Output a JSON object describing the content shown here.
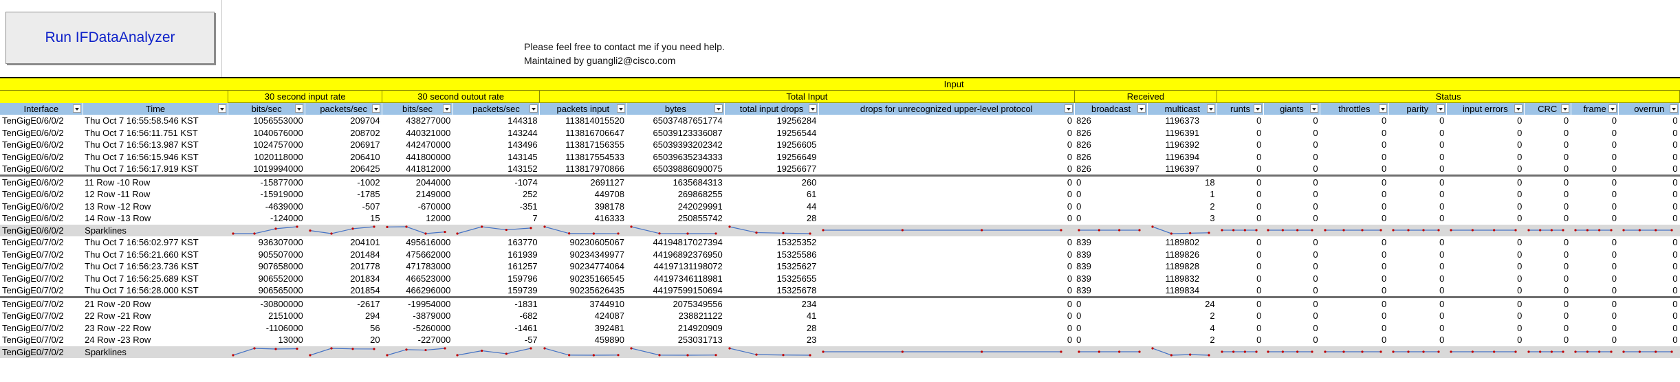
{
  "toolbar": {
    "run_label": "Run IFDataAnalyzer"
  },
  "contact": {
    "line1": "Please feel free to contact me if you need help.",
    "line2": "Maintained by guangli2@cisco.com"
  },
  "bands": {
    "input": "Input",
    "rate_in": "30 second input rate",
    "rate_out": "30 second outout rate",
    "total_input": "Total Input",
    "received": "Received",
    "status": "Status"
  },
  "columns": [
    "Interface",
    "Time",
    "bits/sec",
    "packets/sec",
    "bits/sec",
    "packets/sec",
    "packets input",
    "bytes",
    "total input drops",
    "drops for unrecognized upper-level protocol",
    "broadcast",
    "multicast",
    "runts",
    "giants",
    "throttles",
    "parity",
    "input errors",
    "CRC",
    "frame",
    "overrun"
  ],
  "groups": [
    {
      "rows": [
        [
          "TenGigE0/6/0/2",
          "Thu Oct  7 16:55:58.546 KST",
          "1056553000",
          "209704",
          "438277000",
          "144318",
          "113814015520",
          "65037487651774",
          "19256284",
          "0",
          "826",
          "1196373",
          "0",
          "0",
          "0",
          "0",
          "0",
          "0",
          "0",
          "0"
        ],
        [
          "TenGigE0/6/0/2",
          "Thu Oct  7 16:56:11.751 KST",
          "1040676000",
          "208702",
          "440321000",
          "143244",
          "113816706647",
          "65039123336087",
          "19256544",
          "0",
          "826",
          "1196391",
          "0",
          "0",
          "0",
          "0",
          "0",
          "0",
          "0",
          "0"
        ],
        [
          "TenGigE0/6/0/2",
          "Thu Oct  7 16:56:13.987 KST",
          "1024757000",
          "206917",
          "442470000",
          "143496",
          "113817156355",
          "65039393202342",
          "19256605",
          "0",
          "826",
          "1196392",
          "0",
          "0",
          "0",
          "0",
          "0",
          "0",
          "0",
          "0"
        ],
        [
          "TenGigE0/6/0/2",
          "Thu Oct  7 16:56:15.946 KST",
          "1020118000",
          "206410",
          "441800000",
          "143145",
          "113817554533",
          "65039635234333",
          "19256649",
          "0",
          "826",
          "1196394",
          "0",
          "0",
          "0",
          "0",
          "0",
          "0",
          "0",
          "0"
        ],
        [
          "TenGigE0/6/0/2",
          "Thu Oct  7 16:56:17.919 KST",
          "1019994000",
          "206425",
          "441812000",
          "143152",
          "113817970866",
          "65039886090075",
          "19256677",
          "0",
          "826",
          "1196397",
          "0",
          "0",
          "0",
          "0",
          "0",
          "0",
          "0",
          "0"
        ]
      ],
      "diffs": [
        [
          "TenGigE0/6/0/2",
          "11 Row -10 Row",
          "-15877000",
          "-1002",
          "2044000",
          "-1074",
          "2691127",
          "1635684313",
          "260",
          "0",
          "0",
          "18",
          "0",
          "0",
          "0",
          "0",
          "0",
          "0",
          "0",
          "0"
        ],
        [
          "TenGigE0/6/0/2",
          "12 Row -11 Row",
          "-15919000",
          "-1785",
          "2149000",
          "252",
          "449708",
          "269868255",
          "61",
          "0",
          "0",
          "1",
          "0",
          "0",
          "0",
          "0",
          "0",
          "0",
          "0",
          "0"
        ],
        [
          "TenGigE0/6/0/2",
          "13 Row -12 Row",
          "-4639000",
          "-507",
          "-670000",
          "-351",
          "398178",
          "242029991",
          "44",
          "0",
          "0",
          "2",
          "0",
          "0",
          "0",
          "0",
          "0",
          "0",
          "0",
          "0"
        ],
        [
          "TenGigE0/6/0/2",
          "14 Row -13 Row",
          "-124000",
          "15",
          "12000",
          "7",
          "416333",
          "250855742",
          "28",
          "0",
          "0",
          "3",
          "0",
          "0",
          "0",
          "0",
          "0",
          "0",
          "0",
          "0"
        ]
      ],
      "spark": {
        "interface": "TenGigE0/6/0/2",
        "label": "Sparklines"
      }
    },
    {
      "rows": [
        [
          "TenGigE0/7/0/2",
          "Thu Oct  7 16:56:02.977 KST",
          "936307000",
          "204101",
          "495616000",
          "163770",
          "90230605067",
          "44194817027394",
          "15325352",
          "0",
          "839",
          "1189802",
          "0",
          "0",
          "0",
          "0",
          "0",
          "0",
          "0",
          "0"
        ],
        [
          "TenGigE0/7/0/2",
          "Thu Oct  7 16:56:21.660 KST",
          "905507000",
          "201484",
          "475662000",
          "161939",
          "90234349977",
          "44196892376950",
          "15325586",
          "0",
          "839",
          "1189826",
          "0",
          "0",
          "0",
          "0",
          "0",
          "0",
          "0",
          "0"
        ],
        [
          "TenGigE0/7/0/2",
          "Thu Oct  7 16:56:23.736 KST",
          "907658000",
          "201778",
          "471783000",
          "161257",
          "90234774064",
          "44197131198072",
          "15325627",
          "0",
          "839",
          "1189828",
          "0",
          "0",
          "0",
          "0",
          "0",
          "0",
          "0",
          "0"
        ],
        [
          "TenGigE0/7/0/2",
          "Thu Oct  7 16:56:25.689 KST",
          "906552000",
          "201834",
          "466523000",
          "159796",
          "90235166545",
          "44197346118981",
          "15325655",
          "0",
          "839",
          "1189832",
          "0",
          "0",
          "0",
          "0",
          "0",
          "0",
          "0",
          "0"
        ],
        [
          "TenGigE0/7/0/2",
          "Thu Oct  7 16:56:28.000 KST",
          "906565000",
          "201854",
          "466296000",
          "159739",
          "90235626435",
          "44197599150694",
          "15325678",
          "0",
          "839",
          "1189834",
          "0",
          "0",
          "0",
          "0",
          "0",
          "0",
          "0",
          "0"
        ]
      ],
      "diffs": [
        [
          "TenGigE0/7/0/2",
          "21 Row -20 Row",
          "-30800000",
          "-2617",
          "-19954000",
          "-1831",
          "3744910",
          "2075349556",
          "234",
          "0",
          "0",
          "24",
          "0",
          "0",
          "0",
          "0",
          "0",
          "0",
          "0",
          "0"
        ],
        [
          "TenGigE0/7/0/2",
          "22 Row -21 Row",
          "2151000",
          "294",
          "-3879000",
          "-682",
          "424087",
          "238821122",
          "41",
          "0",
          "0",
          "2",
          "0",
          "0",
          "0",
          "0",
          "0",
          "0",
          "0",
          "0"
        ],
        [
          "TenGigE0/7/0/2",
          "23 Row -22 Row",
          "-1106000",
          "56",
          "-5260000",
          "-1461",
          "392481",
          "214920909",
          "28",
          "0",
          "0",
          "4",
          "0",
          "0",
          "0",
          "0",
          "0",
          "0",
          "0",
          "0"
        ],
        [
          "TenGigE0/7/0/2",
          "24 Row -23 Row",
          "13000",
          "20",
          "-227000",
          "-57",
          "459890",
          "253031713",
          "23",
          "0",
          "0",
          "2",
          "0",
          "0",
          "0",
          "0",
          "0",
          "0",
          "0",
          "0"
        ]
      ],
      "spark": {
        "interface": "TenGigE0/7/0/2",
        "label": "Sparklines"
      }
    }
  ]
}
